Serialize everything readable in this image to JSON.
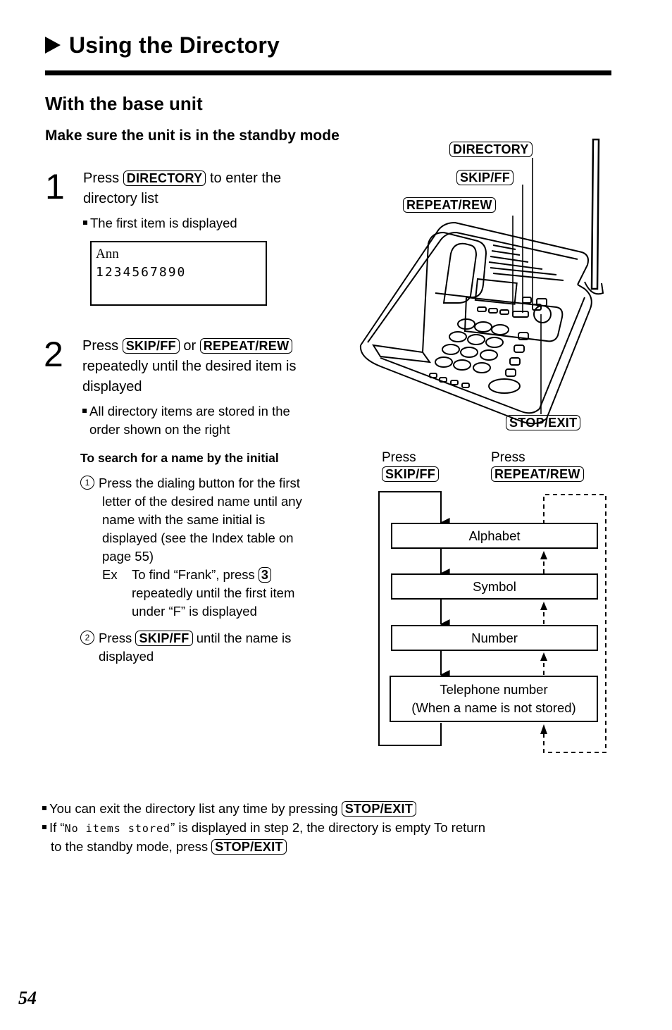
{
  "header": {
    "title": "Using the Directory",
    "section": "With the base unit",
    "prerequisite": "Make sure the unit is in the standby mode"
  },
  "steps": [
    {
      "number": "1",
      "text_before": "Press",
      "key": "DIRECTORY",
      "text_after": "to enter the",
      "text_line2": "directory list",
      "note": "The first item is displayed",
      "display": {
        "line1": "Ann",
        "line2": "1234567890"
      }
    },
    {
      "number": "2",
      "text_before": "Press",
      "key1": "SKIP/FF",
      "connector": "or",
      "key2": "REPEAT/REW",
      "text_line2": "repeatedly until the desired item is",
      "text_line3": "displayed",
      "note_line1": "All directory items are stored in the",
      "note_line2": "order shown on the right"
    }
  ],
  "search": {
    "heading": "To search for a name by the initial",
    "item1": {
      "marker": "1",
      "lines": [
        "Press the dialing button for the first",
        "letter of the desired name until any",
        "name with the same initial is",
        "displayed (see the Index table on",
        "page 55)"
      ],
      "example_label": "Ex",
      "example_before": "To find “Frank”, press",
      "example_key": "3",
      "example_lines": [
        "repeatedly until the first item",
        "under “F” is displayed"
      ]
    },
    "item2": {
      "marker": "2",
      "text_before": "Press",
      "key": "SKIP/FF",
      "text_after": "until the name is",
      "line2": "displayed"
    }
  },
  "illustration": {
    "callouts": [
      "DIRECTORY",
      "SKIP/FF",
      "REPEAT/REW",
      "STOP/EXIT"
    ]
  },
  "flow": {
    "left_label": "Press",
    "left_key": "SKIP/FF",
    "right_label": "Press",
    "right_key": "REPEAT/REW",
    "boxes": [
      {
        "line1": "Alphabet",
        "line2": ""
      },
      {
        "line1": "Symbol",
        "line2": ""
      },
      {
        "line1": "Number",
        "line2": ""
      },
      {
        "line1": "Telephone number",
        "line2": "(When a name is not stored)"
      }
    ]
  },
  "notes": {
    "note1_text": "You can exit the directory list any time by pressing",
    "note1_key": "STOP/EXIT",
    "note2_before": "If “",
    "note2_mono": "No items stored",
    "note2_after": "” is displayed in step 2, the directory is empty  To return",
    "note2_line2": "to the standby mode, press",
    "note2_key": "STOP/EXIT"
  },
  "footer": {
    "page_number": "54"
  }
}
